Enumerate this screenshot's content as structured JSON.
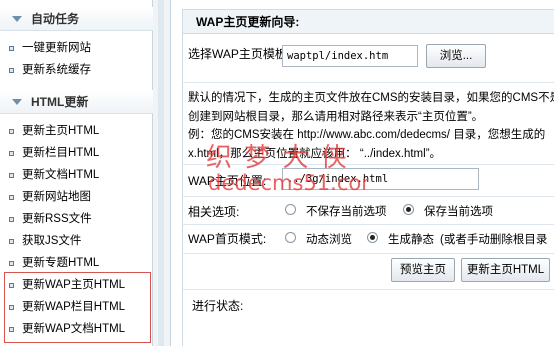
{
  "sidebar": {
    "groups": [
      {
        "title": "自动任务",
        "items": [
          "一键更新网站",
          "更新系统缓存"
        ]
      },
      {
        "title": "HTML更新",
        "items": [
          "更新主页HTML",
          "更新栏目HTML",
          "更新文档HTML",
          "更新网站地图",
          "更新RSS文件",
          "获取JS文件",
          "更新专题HTML",
          "更新WAP主页HTML",
          "更新WAP栏目HTML",
          "更新WAP文档HTML"
        ]
      }
    ]
  },
  "main": {
    "title": "WAP主页更新向导:",
    "template_label": "选择WAP主页模板:",
    "template_value": "waptpl/index.htm",
    "browse_button": "浏览...",
    "description": [
      "默认的情况下，生成的主页文件放在CMS的安装目录，如果您的CMS不是",
      "创建到网站根目录，那么请用相对路径来表示“主页位置”。",
      "例：您的CMS安装在 http://www.abc.com/dedecms/ 目录，您想生成的",
      "x.html，那么主页位置就应该用： “../index.html”。"
    ],
    "position_label": "WAP主页位置:",
    "position_value": "../3g/index.html",
    "options_label": "相关选项:",
    "options": [
      {
        "label": "不保存当前选项",
        "checked": false
      },
      {
        "label": "保存当前选项",
        "checked": true
      }
    ],
    "mode_label": "WAP首页模式:",
    "modes": [
      {
        "label": "动态浏览",
        "checked": false
      },
      {
        "label": "生成静态",
        "checked": true
      }
    ],
    "mode_note": "(或者手动删除根目录",
    "preview_button": "预览主页",
    "update_button": "更新主页HTML",
    "progress_label": "进行状态:"
  },
  "watermark": {
    "line1": "织 梦 大 侠",
    "line2": "dedecms51.com"
  },
  "colors": {
    "highlight_border": "#d9534f",
    "watermark": "#e23c3c",
    "header_bg": "#eef4f8"
  }
}
